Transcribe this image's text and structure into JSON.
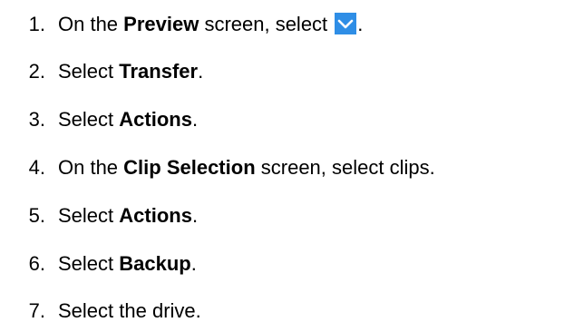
{
  "steps": [
    {
      "number": "1.",
      "pre": "On the ",
      "bold": "Preview",
      "post": " screen, select ",
      "icon": "chevron-down-icon",
      "after_icon": "."
    },
    {
      "number": "2.",
      "pre": "Select ",
      "bold": "Transfer",
      "post": "."
    },
    {
      "number": "3.",
      "pre": "Select ",
      "bold": "Actions",
      "post": "."
    },
    {
      "number": "4.",
      "pre": "On the ",
      "bold": "Clip Selection",
      "post": " screen, select clips."
    },
    {
      "number": "5.",
      "pre": "Select ",
      "bold": "Actions",
      "post": "."
    },
    {
      "number": "6.",
      "pre": "Select ",
      "bold": "Backup",
      "post": "."
    },
    {
      "number": "7.",
      "pre": "Select the drive.",
      "bold": "",
      "post": ""
    }
  ],
  "colors": {
    "icon_background": "#2f8ee6",
    "icon_glyph": "#ffffff"
  }
}
